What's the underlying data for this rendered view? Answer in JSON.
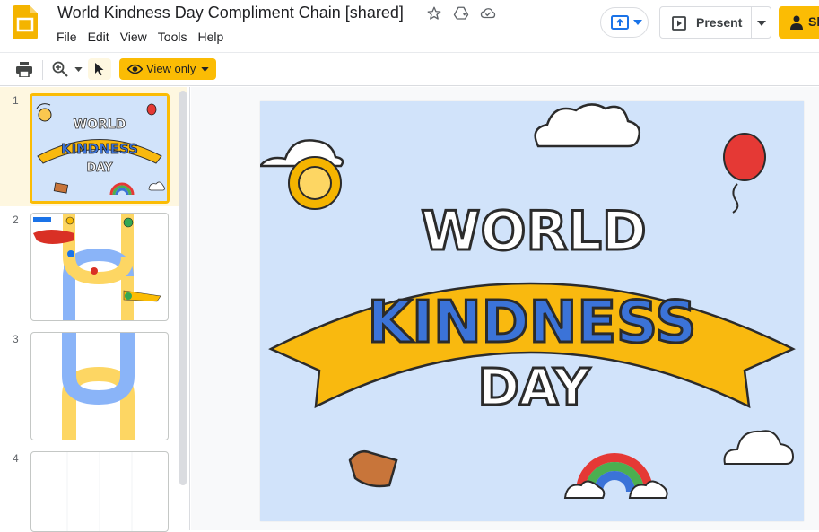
{
  "app": {
    "title": "World Kindness Day Compliment Chain [shared]",
    "menu": [
      "File",
      "Edit",
      "View",
      "Tools",
      "Help"
    ],
    "present_label": "Present",
    "share_label": "Sh",
    "view_only_label": "View only"
  },
  "slides": [
    {
      "number": "1",
      "selected": true
    },
    {
      "number": "2",
      "selected": false
    },
    {
      "number": "3",
      "selected": false
    },
    {
      "number": "4",
      "selected": false
    }
  ],
  "main_slide": {
    "line1": "WORLD",
    "line2": "KINDNESS",
    "line3": "DAY"
  },
  "thumb1": {
    "line1": "WORLD",
    "line2": "KINDNESS",
    "line3": "DAY"
  },
  "colors": {
    "accent": "#fbbc04",
    "slide_bg": "#d1e3fa",
    "ribbon": "#f9b90f",
    "kindness_blue": "#3b73d8",
    "yellow_logo": "#f4b400"
  }
}
